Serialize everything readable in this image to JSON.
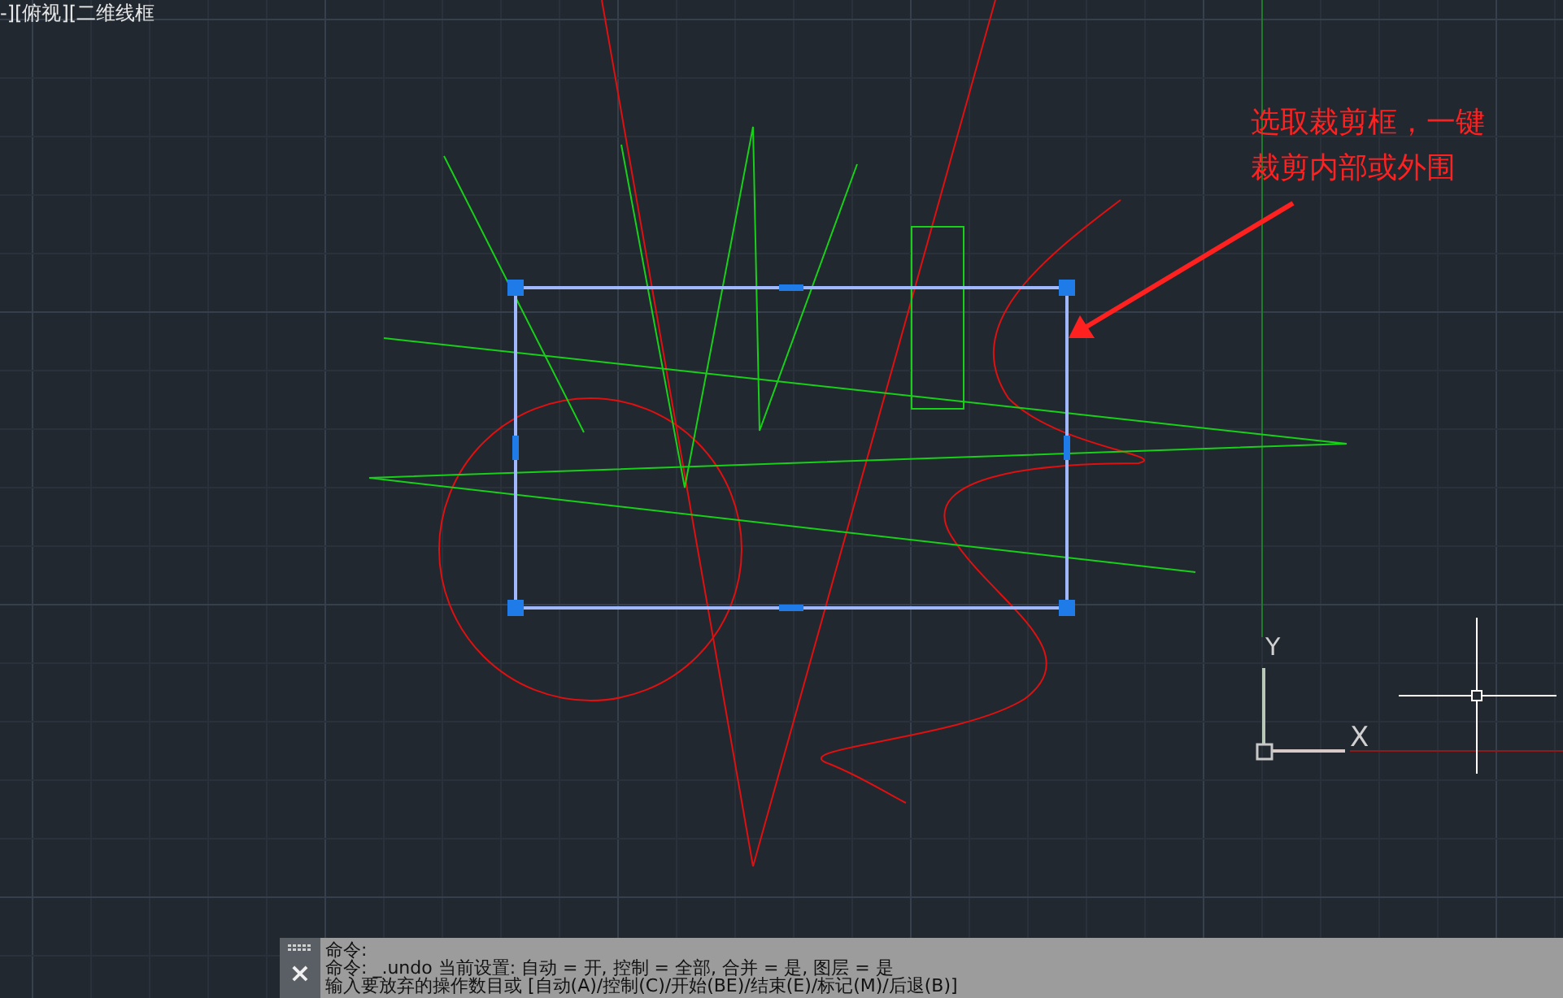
{
  "viewport_label": "-][俯视][二维线框",
  "annotation": {
    "lines": [
      "选取裁剪框，一键",
      "裁剪内部或外围"
    ]
  },
  "ucs": {
    "y_label": "Y",
    "x_label": "X"
  },
  "command_line": {
    "close": "×",
    "lines": [
      "命令:",
      "命令: _.undo 当前设置: 自动 = 开, 控制 = 全部, 合并 = 是, 图层 = 是",
      "输入要放弃的操作数目或 [自动(A)/控制(C)/开始(BE)/结束(E)/标记(M)/后退(B)]"
    ]
  }
}
